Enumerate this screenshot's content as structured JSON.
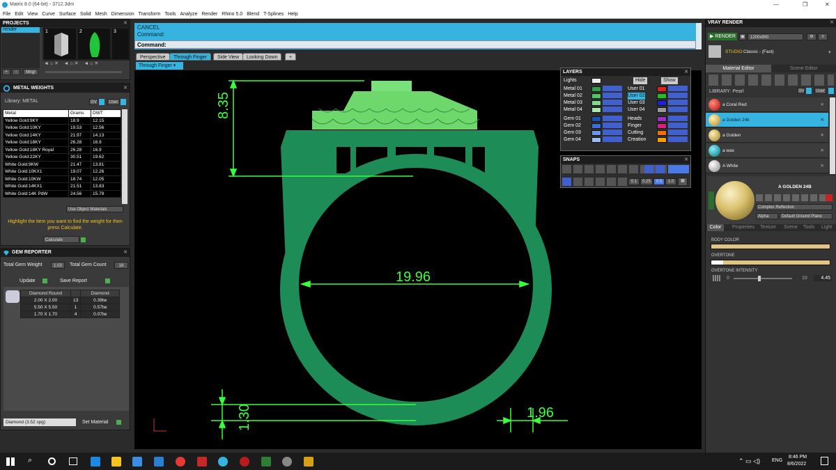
{
  "window": {
    "title": "Matrix 8.0 (64-bit) - 3712.3dm",
    "min": "—",
    "max": "❐",
    "close": "✕"
  },
  "menu": [
    "File",
    "Edit",
    "View",
    "Curve",
    "Surface",
    "Solid",
    "Mesh",
    "Dimension",
    "Transform",
    "Tools",
    "Analyze",
    "Render",
    "Rhino 5.0",
    "Blend",
    "T-Splines",
    "Help"
  ],
  "projects": {
    "title": "PROJECTS",
    "item": "render",
    "thumb_numbers": [
      "1",
      "2",
      "3"
    ],
    "mngr": "Mngr"
  },
  "metal_weights": {
    "title": "METAL WEIGHTS",
    "library_label": "Library: METAL",
    "gv": "GV",
    "user": "User",
    "columns": [
      "Metal",
      "Grams",
      "DWT"
    ],
    "rows": [
      [
        "Yellow Gold:9KY",
        "18.9",
        "12.15"
      ],
      [
        "Yellow Gold:10KY",
        "19.53",
        "12.56"
      ],
      [
        "Yellow Gold:14KY",
        "21.97",
        "14.13"
      ],
      [
        "Yellow Gold:18KY",
        "26.28",
        "16.9"
      ],
      [
        "Yellow Gold:18KY Royal",
        "26.28",
        "16.9"
      ],
      [
        "Yellow Gold:22KY",
        "30.51",
        "19.62"
      ],
      [
        "White Gold:9KW",
        "21.47",
        "13.81"
      ],
      [
        "White Gold:10KX1",
        "19.07",
        "12.26"
      ],
      [
        "White Gold:10KW",
        "18.74",
        "12.05"
      ],
      [
        "White Gold:14KX1",
        "21.51",
        "13.83"
      ],
      [
        "White Gold:14K PdW",
        "24.56",
        "15.79"
      ]
    ],
    "use_object_materials": "Use Object Materials",
    "instructions": "Highlight the item you want to find the weight for then press Calculate.",
    "calculate": "Calculate"
  },
  "gem_reporter": {
    "title": "GEM REPORTER",
    "total_weight_label": "Total Gem Weight",
    "total_weight": "1.03",
    "total_count_label": "Total Gem Count",
    "total_count": "18",
    "update": "Update",
    "save_report": "Save Report",
    "columns": [
      "Diamond Round",
      "",
      "Diamond"
    ],
    "rows": [
      [
        "2.00 X 2.00",
        "13",
        "0.39tw"
      ],
      [
        "5.50 X 5.50",
        "1",
        "0.57tw"
      ],
      [
        "1.70 X 1.70",
        "4",
        "0.07tw"
      ]
    ],
    "material_select": "Diamond   (3.52 spg)",
    "set_material": "Set Material"
  },
  "command": {
    "line1": "CANCEL",
    "line2": "Command:",
    "prompt": "Command:"
  },
  "tabs": [
    "Perspective",
    "Through Finger",
    "Side View",
    "Looking Down",
    "+"
  ],
  "active_tab": "Through Finger",
  "viewport_label": "Through Finger",
  "dimensions": {
    "top": "8.35",
    "width": "19.96",
    "shank": "1.30",
    "side": "1.96"
  },
  "layers": {
    "title": "LAYERS",
    "lights": "Lights",
    "hide": "Hide",
    "show": "Show",
    "left": [
      "Metal 01",
      "Metal 02",
      "Metal 03",
      "Metal 04",
      "Gem 01",
      "Gem 02",
      "Gem 03",
      "Gem 04"
    ],
    "right": [
      "User 01",
      "User 02",
      "User 03",
      "User 04",
      "Heads",
      "Finger",
      "Cutting",
      "Creation"
    ]
  },
  "snaps": {
    "title": "SNAPS",
    "values": [
      "0.1",
      "0.25",
      "0.5",
      "1.0"
    ]
  },
  "vray": {
    "title": "VRAY RENDER",
    "render": "RENDER",
    "size": "1200x900",
    "preset_mode": "STUDIO",
    "preset": "Classic - (Fast)",
    "tabs": [
      "Material Editor",
      "Scene Editor"
    ],
    "library": "LIBRARY: Pearl",
    "materials": [
      "a Coral Red",
      "a Golden 24k",
      "a Golden",
      "a wax",
      "A White"
    ],
    "selected_material": "A GOLDEN 24B",
    "complex": "Complex Reflection",
    "alpha": "Alpha",
    "ground": "Default Ground Plane",
    "subtabs": [
      "Color",
      "Properties",
      "Texture",
      "Scene",
      "Tools",
      "Light"
    ],
    "body_color": "BODY COLOR",
    "overtone": "OVERTONE",
    "overtone_intensity": "OVERTONE INTENSITY",
    "intensity_min": "0",
    "intensity_max": "10",
    "intensity_value": "4.45"
  },
  "taskbar": {
    "lang": "ENG",
    "time": "8:46 PM",
    "date": "8/6/2022"
  },
  "colors": {
    "accent": "#37b3e0",
    "model_green": "#1e8c57",
    "dim_green": "#39ff3c"
  }
}
